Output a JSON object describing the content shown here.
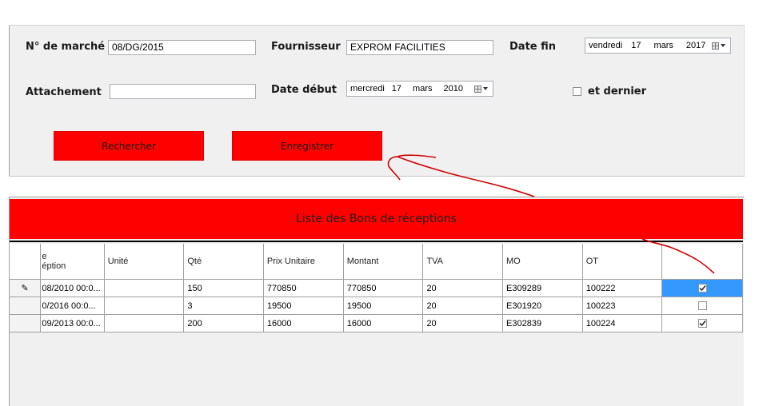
{
  "form": {
    "marche_label": "N° de marché",
    "marche_value": "08/DG/2015",
    "fournisseur_label": "Fournisseur",
    "fournisseur_value": "EXPROM FACILITIES",
    "date_fin_label": "Date fin",
    "date_fin": {
      "weekday": "vendredi",
      "day": "17",
      "month": "mars",
      "year": "2017"
    },
    "attachement_label": "Attachement",
    "attachement_value": "",
    "date_debut_label": "Date début",
    "date_debut": {
      "weekday": "mercredi",
      "day": "17",
      "month": "mars",
      "year": "2010"
    },
    "et_dernier_label": "et dernier",
    "et_dernier_checked": false,
    "rechercher_label": "Rechercher",
    "enregistrer_label": "Enregistrer"
  },
  "grid": {
    "title": "Liste des Bons de réceptions",
    "columns": [
      "e\néption",
      "Unité",
      "Qté",
      "Prix Unitaire",
      "Montant",
      "TVA",
      "MO",
      "OT",
      ""
    ],
    "rows": [
      {
        "indicator": "✎",
        "date": "08/2010 00:0...",
        "unite": "",
        "qte": "150",
        "prix": "770850",
        "montant": "770850",
        "tva": "20",
        "mo": "E309289",
        "ot": "100222",
        "checked": true,
        "selected": true
      },
      {
        "indicator": "",
        "date": "0/2016 00:0...",
        "unite": "",
        "qte": "3",
        "prix": "19500",
        "montant": "19500",
        "tva": "20",
        "mo": "E301920",
        "ot": "100223",
        "checked": false,
        "selected": false
      },
      {
        "indicator": "",
        "date": "09/2013 00:0...",
        "unite": "",
        "qte": "200",
        "prix": "16000",
        "montant": "16000",
        "tva": "20",
        "mo": "E302839",
        "ot": "100224",
        "checked": true,
        "selected": false
      }
    ]
  },
  "colors": {
    "accent_red": "#fe0000",
    "selection_blue": "#3399ff",
    "annotation_red": "#d00000"
  },
  "icons": {
    "calendar": "calendar-icon",
    "dropdown": "chevron-down-icon",
    "edit_row": "pencil-icon",
    "checkbox": "check-icon"
  }
}
